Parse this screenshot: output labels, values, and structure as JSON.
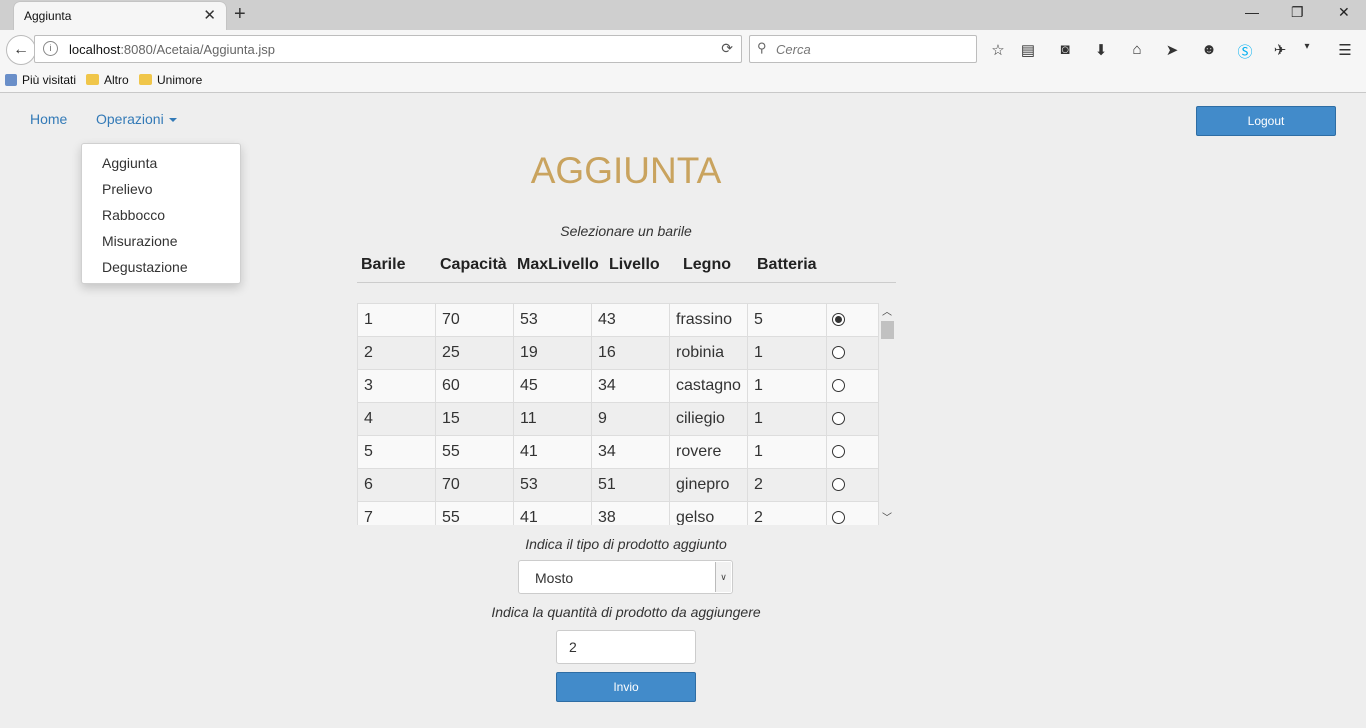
{
  "browser": {
    "tab_title": "Aggiunta",
    "url_host": "localhost",
    "url_rest": ":8080/Acetaia/Aggiunta.jsp",
    "search_placeholder": "Cerca",
    "bookmarks": [
      "Più visitati",
      "Altro",
      "Unimore"
    ]
  },
  "nav": {
    "home": "Home",
    "operazioni": "Operazioni",
    "logout": "Logout",
    "menu": [
      "Aggiunta",
      "Prelievo",
      "Rabbocco",
      "Misurazione",
      "Degustazione"
    ]
  },
  "page": {
    "title": "AGGIUNTA",
    "select_barrel": "Selezionare un barile",
    "product_type_label": "Indica il tipo di prodotto aggiunto",
    "product_type_value": "Mosto",
    "quantity_label": "Indica la quantità di prodotto da aggiungere",
    "quantity_value": "2",
    "submit": "Invio"
  },
  "table": {
    "headers": [
      "Barile",
      "Capacità",
      "MaxLivello",
      "Livello",
      "Legno",
      "Batteria"
    ],
    "rows": [
      [
        "1",
        "70",
        "53",
        "43",
        "frassino",
        "5"
      ],
      [
        "2",
        "25",
        "19",
        "16",
        "robinia",
        "1"
      ],
      [
        "3",
        "60",
        "45",
        "34",
        "castagno",
        "1"
      ],
      [
        "4",
        "15",
        "11",
        "9",
        "ciliegio",
        "1"
      ],
      [
        "5",
        "55",
        "41",
        "34",
        "rovere",
        "1"
      ],
      [
        "6",
        "70",
        "53",
        "51",
        "ginepro",
        "2"
      ],
      [
        "7",
        "55",
        "41",
        "38",
        "gelso",
        "2"
      ]
    ],
    "selected_row": 0
  },
  "colors": {
    "accent": "#428bca",
    "link": "#337ab7",
    "title": "#c9a35e"
  }
}
